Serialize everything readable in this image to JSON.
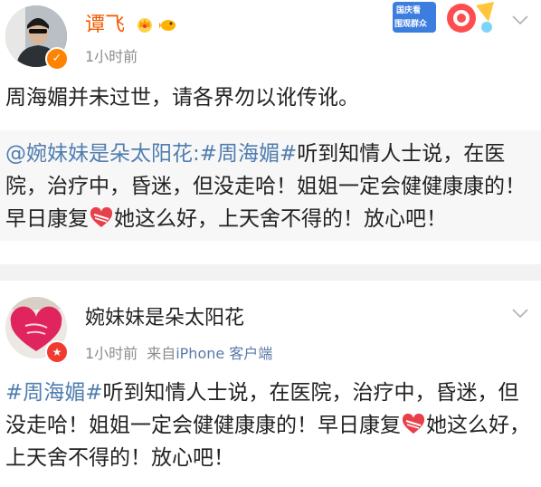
{
  "post1": {
    "username": "谭飞",
    "time": "1小时前",
    "text": "周海媚并未过世，请各界勿以讹传讹。",
    "banner_line1": "国庆看",
    "banner_line2": "围观群众",
    "repost": {
      "mention": "@婉妹妹是朵太阳花:",
      "hashtag": "#周海媚#",
      "text_before_heart": "听到知情人士说，在医院，治疗中，昏迷，但没走哈！姐姐一定会健健康康的！早日康复",
      "text_after_heart": "她这么好，上天舍不得的！放心吧！"
    }
  },
  "post2": {
    "username": "婉妹妹是朵太阳花",
    "time": "1小时前",
    "source_prefix": "来自",
    "device": "iPhone 客户端",
    "hashtag": "#周海媚#",
    "text_before_heart": "听到知情人士说，在医院，治疗中，昏迷，但没走哈！姐姐一定会健健康康的！早日康复",
    "text_after_heart": "她这么好，上天舍不得的！放心吧！"
  },
  "colors": {
    "vip_orange": "#f25900",
    "link_blue": "#507daf",
    "meta_gray": "#8c8c8c",
    "repost_bg": "#f7f7f7"
  },
  "icons": [
    "crown-icon",
    "fish-icon",
    "verified-icon",
    "chevron-down-icon",
    "heart-emoji-icon"
  ]
}
